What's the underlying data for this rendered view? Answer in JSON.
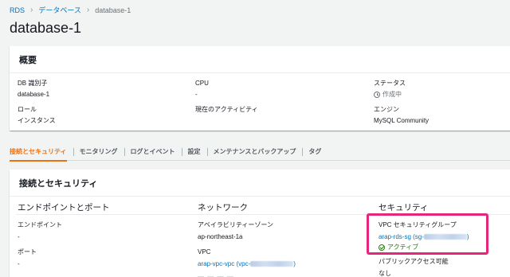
{
  "breadcrumb": {
    "rds": "RDS",
    "databases": "データベース",
    "current": "database-1"
  },
  "page_title": "database-1",
  "summary": {
    "header": "概要",
    "db_id_label": "DB 識別子",
    "db_id_value": "database-1",
    "cpu_label": "CPU",
    "cpu_value": "-",
    "status_label": "ステータス",
    "status_value": "作成中",
    "role_label": "ロール",
    "role_value": "インスタンス",
    "activity_label": "現在のアクティビティ",
    "engine_label": "エンジン",
    "engine_value": "MySQL Community"
  },
  "tabs": [
    {
      "label": "接続とセキュリティ",
      "active": true
    },
    {
      "label": "モニタリング",
      "active": false
    },
    {
      "label": "ログとイベント",
      "active": false
    },
    {
      "label": "設定",
      "active": false
    },
    {
      "label": "メンテナンスとバックアップ",
      "active": false
    },
    {
      "label": "タグ",
      "active": false
    }
  ],
  "connectivity": {
    "header": "接続とセキュリティ",
    "endpoint_col": {
      "title": "エンドポイントとポート",
      "endpoint_label": "エンドポイント",
      "endpoint_value": "-",
      "port_label": "ポート",
      "port_value": "-"
    },
    "network_col": {
      "title": "ネットワーク",
      "az_label": "アベイラビリティーゾーン",
      "az_value": "ap-northeast-1a",
      "vpc_label": "VPC",
      "vpc_link": "arap-vpc-vpc (vpc-",
      "vpc_link_end": ")"
    },
    "security_col": {
      "title": "セキュリティ",
      "sg_label": "VPC セキュリティグループ",
      "sg_link": "arap-rds-sg (sg-",
      "sg_link_end": ")",
      "sg_status": "アクティブ",
      "public_label": "パブリックアクセス可能",
      "public_value": "なし"
    }
  },
  "colors": {
    "accent": "#ec7211",
    "link": "#0073bb",
    "success": "#1d8102",
    "highlight": "#e5267b"
  }
}
